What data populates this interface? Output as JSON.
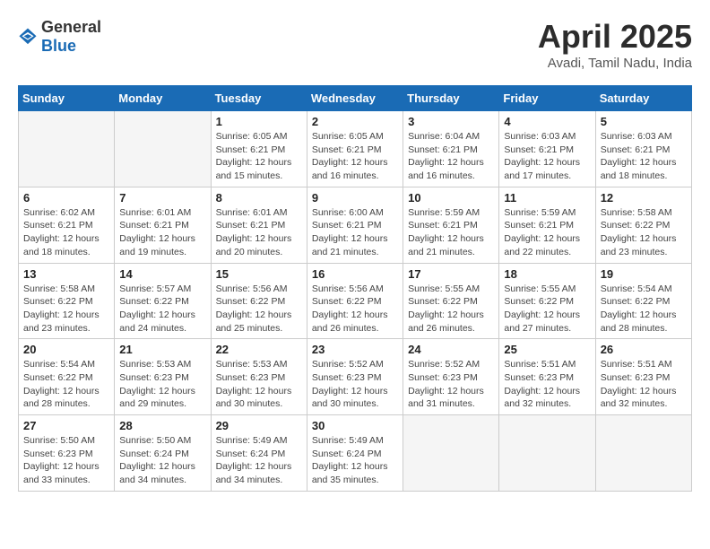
{
  "logo": {
    "general": "General",
    "blue": "Blue"
  },
  "title": "April 2025",
  "location": "Avadi, Tamil Nadu, India",
  "days_of_week": [
    "Sunday",
    "Monday",
    "Tuesday",
    "Wednesday",
    "Thursday",
    "Friday",
    "Saturday"
  ],
  "weeks": [
    [
      {
        "day": "",
        "empty": true
      },
      {
        "day": "",
        "empty": true
      },
      {
        "day": "1",
        "sunrise": "Sunrise: 6:05 AM",
        "sunset": "Sunset: 6:21 PM",
        "daylight": "Daylight: 12 hours and 15 minutes."
      },
      {
        "day": "2",
        "sunrise": "Sunrise: 6:05 AM",
        "sunset": "Sunset: 6:21 PM",
        "daylight": "Daylight: 12 hours and 16 minutes."
      },
      {
        "day": "3",
        "sunrise": "Sunrise: 6:04 AM",
        "sunset": "Sunset: 6:21 PM",
        "daylight": "Daylight: 12 hours and 16 minutes."
      },
      {
        "day": "4",
        "sunrise": "Sunrise: 6:03 AM",
        "sunset": "Sunset: 6:21 PM",
        "daylight": "Daylight: 12 hours and 17 minutes."
      },
      {
        "day": "5",
        "sunrise": "Sunrise: 6:03 AM",
        "sunset": "Sunset: 6:21 PM",
        "daylight": "Daylight: 12 hours and 18 minutes."
      }
    ],
    [
      {
        "day": "6",
        "sunrise": "Sunrise: 6:02 AM",
        "sunset": "Sunset: 6:21 PM",
        "daylight": "Daylight: 12 hours and 18 minutes."
      },
      {
        "day": "7",
        "sunrise": "Sunrise: 6:01 AM",
        "sunset": "Sunset: 6:21 PM",
        "daylight": "Daylight: 12 hours and 19 minutes."
      },
      {
        "day": "8",
        "sunrise": "Sunrise: 6:01 AM",
        "sunset": "Sunset: 6:21 PM",
        "daylight": "Daylight: 12 hours and 20 minutes."
      },
      {
        "day": "9",
        "sunrise": "Sunrise: 6:00 AM",
        "sunset": "Sunset: 6:21 PM",
        "daylight": "Daylight: 12 hours and 21 minutes."
      },
      {
        "day": "10",
        "sunrise": "Sunrise: 5:59 AM",
        "sunset": "Sunset: 6:21 PM",
        "daylight": "Daylight: 12 hours and 21 minutes."
      },
      {
        "day": "11",
        "sunrise": "Sunrise: 5:59 AM",
        "sunset": "Sunset: 6:21 PM",
        "daylight": "Daylight: 12 hours and 22 minutes."
      },
      {
        "day": "12",
        "sunrise": "Sunrise: 5:58 AM",
        "sunset": "Sunset: 6:22 PM",
        "daylight": "Daylight: 12 hours and 23 minutes."
      }
    ],
    [
      {
        "day": "13",
        "sunrise": "Sunrise: 5:58 AM",
        "sunset": "Sunset: 6:22 PM",
        "daylight": "Daylight: 12 hours and 23 minutes."
      },
      {
        "day": "14",
        "sunrise": "Sunrise: 5:57 AM",
        "sunset": "Sunset: 6:22 PM",
        "daylight": "Daylight: 12 hours and 24 minutes."
      },
      {
        "day": "15",
        "sunrise": "Sunrise: 5:56 AM",
        "sunset": "Sunset: 6:22 PM",
        "daylight": "Daylight: 12 hours and 25 minutes."
      },
      {
        "day": "16",
        "sunrise": "Sunrise: 5:56 AM",
        "sunset": "Sunset: 6:22 PM",
        "daylight": "Daylight: 12 hours and 26 minutes."
      },
      {
        "day": "17",
        "sunrise": "Sunrise: 5:55 AM",
        "sunset": "Sunset: 6:22 PM",
        "daylight": "Daylight: 12 hours and 26 minutes."
      },
      {
        "day": "18",
        "sunrise": "Sunrise: 5:55 AM",
        "sunset": "Sunset: 6:22 PM",
        "daylight": "Daylight: 12 hours and 27 minutes."
      },
      {
        "day": "19",
        "sunrise": "Sunrise: 5:54 AM",
        "sunset": "Sunset: 6:22 PM",
        "daylight": "Daylight: 12 hours and 28 minutes."
      }
    ],
    [
      {
        "day": "20",
        "sunrise": "Sunrise: 5:54 AM",
        "sunset": "Sunset: 6:22 PM",
        "daylight": "Daylight: 12 hours and 28 minutes."
      },
      {
        "day": "21",
        "sunrise": "Sunrise: 5:53 AM",
        "sunset": "Sunset: 6:23 PM",
        "daylight": "Daylight: 12 hours and 29 minutes."
      },
      {
        "day": "22",
        "sunrise": "Sunrise: 5:53 AM",
        "sunset": "Sunset: 6:23 PM",
        "daylight": "Daylight: 12 hours and 30 minutes."
      },
      {
        "day": "23",
        "sunrise": "Sunrise: 5:52 AM",
        "sunset": "Sunset: 6:23 PM",
        "daylight": "Daylight: 12 hours and 30 minutes."
      },
      {
        "day": "24",
        "sunrise": "Sunrise: 5:52 AM",
        "sunset": "Sunset: 6:23 PM",
        "daylight": "Daylight: 12 hours and 31 minutes."
      },
      {
        "day": "25",
        "sunrise": "Sunrise: 5:51 AM",
        "sunset": "Sunset: 6:23 PM",
        "daylight": "Daylight: 12 hours and 32 minutes."
      },
      {
        "day": "26",
        "sunrise": "Sunrise: 5:51 AM",
        "sunset": "Sunset: 6:23 PM",
        "daylight": "Daylight: 12 hours and 32 minutes."
      }
    ],
    [
      {
        "day": "27",
        "sunrise": "Sunrise: 5:50 AM",
        "sunset": "Sunset: 6:23 PM",
        "daylight": "Daylight: 12 hours and 33 minutes."
      },
      {
        "day": "28",
        "sunrise": "Sunrise: 5:50 AM",
        "sunset": "Sunset: 6:24 PM",
        "daylight": "Daylight: 12 hours and 34 minutes."
      },
      {
        "day": "29",
        "sunrise": "Sunrise: 5:49 AM",
        "sunset": "Sunset: 6:24 PM",
        "daylight": "Daylight: 12 hours and 34 minutes."
      },
      {
        "day": "30",
        "sunrise": "Sunrise: 5:49 AM",
        "sunset": "Sunset: 6:24 PM",
        "daylight": "Daylight: 12 hours and 35 minutes."
      },
      {
        "day": "",
        "empty": true
      },
      {
        "day": "",
        "empty": true
      },
      {
        "day": "",
        "empty": true
      }
    ]
  ]
}
